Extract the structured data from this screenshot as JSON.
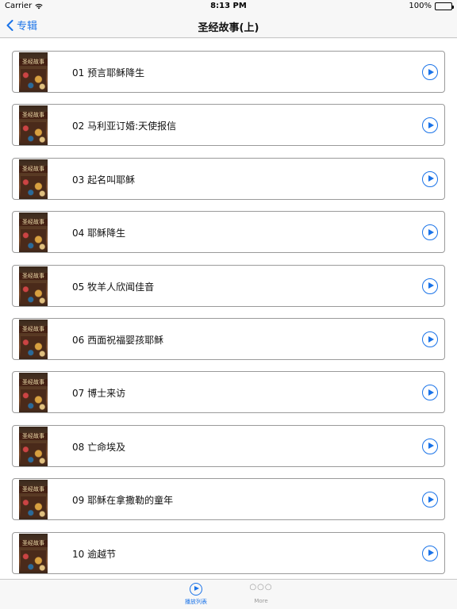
{
  "status_bar": {
    "carrier": "Carrier",
    "time": "8:13 PM",
    "battery": "100%"
  },
  "nav": {
    "back_label": "专辑",
    "title": "圣经故事(上)"
  },
  "cover_text": "圣经故事",
  "episodes": [
    {
      "title": "01 预言耶稣降生"
    },
    {
      "title": "02 马利亚订婚:天使报信"
    },
    {
      "title": "03 起名叫耶稣"
    },
    {
      "title": "04 耶稣降生"
    },
    {
      "title": "05 牧羊人欣闻佳音"
    },
    {
      "title": "06 西面祝福婴孩耶稣"
    },
    {
      "title": "07 博士来访"
    },
    {
      "title": "08 亡命埃及"
    },
    {
      "title": "09 耶稣在拿撒勒的童年"
    },
    {
      "title": "10 逾越节"
    }
  ],
  "tabs": [
    {
      "label": "播放列表",
      "icon": "play-circle-icon",
      "active": true
    },
    {
      "label": "More",
      "icon": "more-dots-icon",
      "active": false,
      "glyph": "○○○"
    }
  ],
  "colors": {
    "accent": "#1a73e8",
    "border": "#9a9a9a",
    "bar_bg": "#f7f7f7"
  }
}
